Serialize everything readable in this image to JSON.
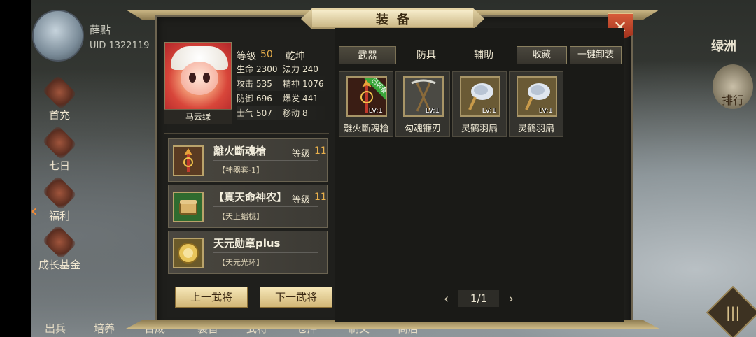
{
  "background": {
    "player_name": "薛點",
    "uid": "UID 1322119",
    "left_menu": [
      {
        "label": "首充",
        "icon": "first-charge-icon"
      },
      {
        "label": "七日",
        "icon": "seven-day-icon"
      },
      {
        "label": "福利",
        "icon": "welfare-icon"
      },
      {
        "label": "成长基金",
        "icon": "growth-fund-icon"
      }
    ],
    "right_title": "绿洲",
    "right_rank": "排行",
    "bottom_menu": [
      "出兵",
      "培养",
      "合成",
      "装备",
      "武将",
      "仓库",
      "制文",
      "商店"
    ],
    "corner_button": "|||"
  },
  "window": {
    "title": "装备",
    "close_label": "✕"
  },
  "hero": {
    "name": "马云绿",
    "level_label": "等级",
    "level": "50",
    "camp": "乾坤",
    "stats": [
      {
        "k": "生命",
        "v": "2300",
        "k2": "法力",
        "v2": "240"
      },
      {
        "k": "攻击",
        "v": "535",
        "k2": "精神",
        "v2": "1076"
      },
      {
        "k": "防御",
        "v": "696",
        "k2": "爆发",
        "v2": "441"
      },
      {
        "k": "士气",
        "v": "507",
        "k2": "移动",
        "v2": "8"
      }
    ]
  },
  "equipped": [
    {
      "name": "離火斷魂槍",
      "level_label": "等级",
      "level": "11",
      "sub": "【神器套-1】",
      "icon": "spear-icon"
    },
    {
      "name": "【真天命神农】",
      "level_label": "等级",
      "level": "11",
      "sub": "【天上蟠桃】",
      "icon": "chest-icon"
    },
    {
      "name": "天元勋章plus",
      "level_label": "",
      "level": "",
      "sub": "【天元光环】",
      "icon": "medal-icon"
    }
  ],
  "buttons": {
    "prev": "上一武将",
    "next": "下一武将",
    "collect": "收藏",
    "unequip_all": "一键卸装"
  },
  "tabs": [
    "武器",
    "防具",
    "辅助"
  ],
  "items": [
    {
      "name": "離火斷魂槍",
      "lv": "LV:1",
      "equipped_tag": "已装备",
      "icon": "spear-icon"
    },
    {
      "name": "勾魂镰刃",
      "lv": "LV:1",
      "equipped_tag": "",
      "icon": "sickle-icon"
    },
    {
      "name": "灵鹤羽扇",
      "lv": "LV:1",
      "equipped_tag": "",
      "icon": "feather-fan-icon"
    },
    {
      "name": "灵鹤羽扇",
      "lv": "LV:1",
      "equipped_tag": "",
      "icon": "feather-fan-icon"
    }
  ],
  "pager": {
    "prev": "‹",
    "page": "1/1",
    "next": "›"
  },
  "colors": {
    "accent_gold": "#e9b04c",
    "equipped_green": "#3aa53a",
    "close_red": "#c2452b"
  }
}
